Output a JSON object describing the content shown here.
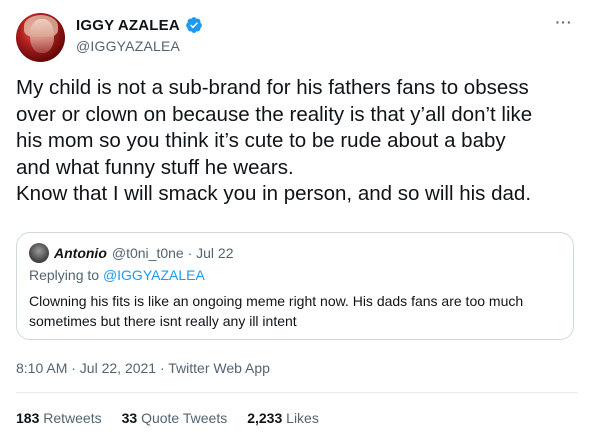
{
  "author": {
    "display_name": "IGGY AZALEA",
    "handle": "@IGGYAZALEA",
    "verified": true
  },
  "tweet": {
    "text": "My child is not a sub-brand for his fathers fans to obsess\nover or clown on because the reality is that y’all don’t like\nhis mom so you think it’s cute to be rude about a baby\nand what funny stuff he wears.\nKnow that I will smack you in person, and so will his dad.",
    "more_icon": "···"
  },
  "quote": {
    "name": "Antonio",
    "meta": "@t0ni_t0ne · Jul 22",
    "reply_prefix": "Replying to ",
    "reply_mention": "@IGGYAZALEA",
    "text": "Clowning his fits is like an ongoing meme right now. His dads fans are too much sometimes but there isnt really any ill intent"
  },
  "timestamp": "8:10 AM · Jul 22, 2021 · Twitter Web App",
  "stats": [
    {
      "count": "183",
      "label": "Retweets"
    },
    {
      "count": "33",
      "label": "Quote Tweets"
    },
    {
      "count": "2,233",
      "label": "Likes"
    }
  ],
  "colors": {
    "verified_blue": "#1d9bf0",
    "mention_blue": "#1d9bf0",
    "secondary_text": "#536471"
  }
}
